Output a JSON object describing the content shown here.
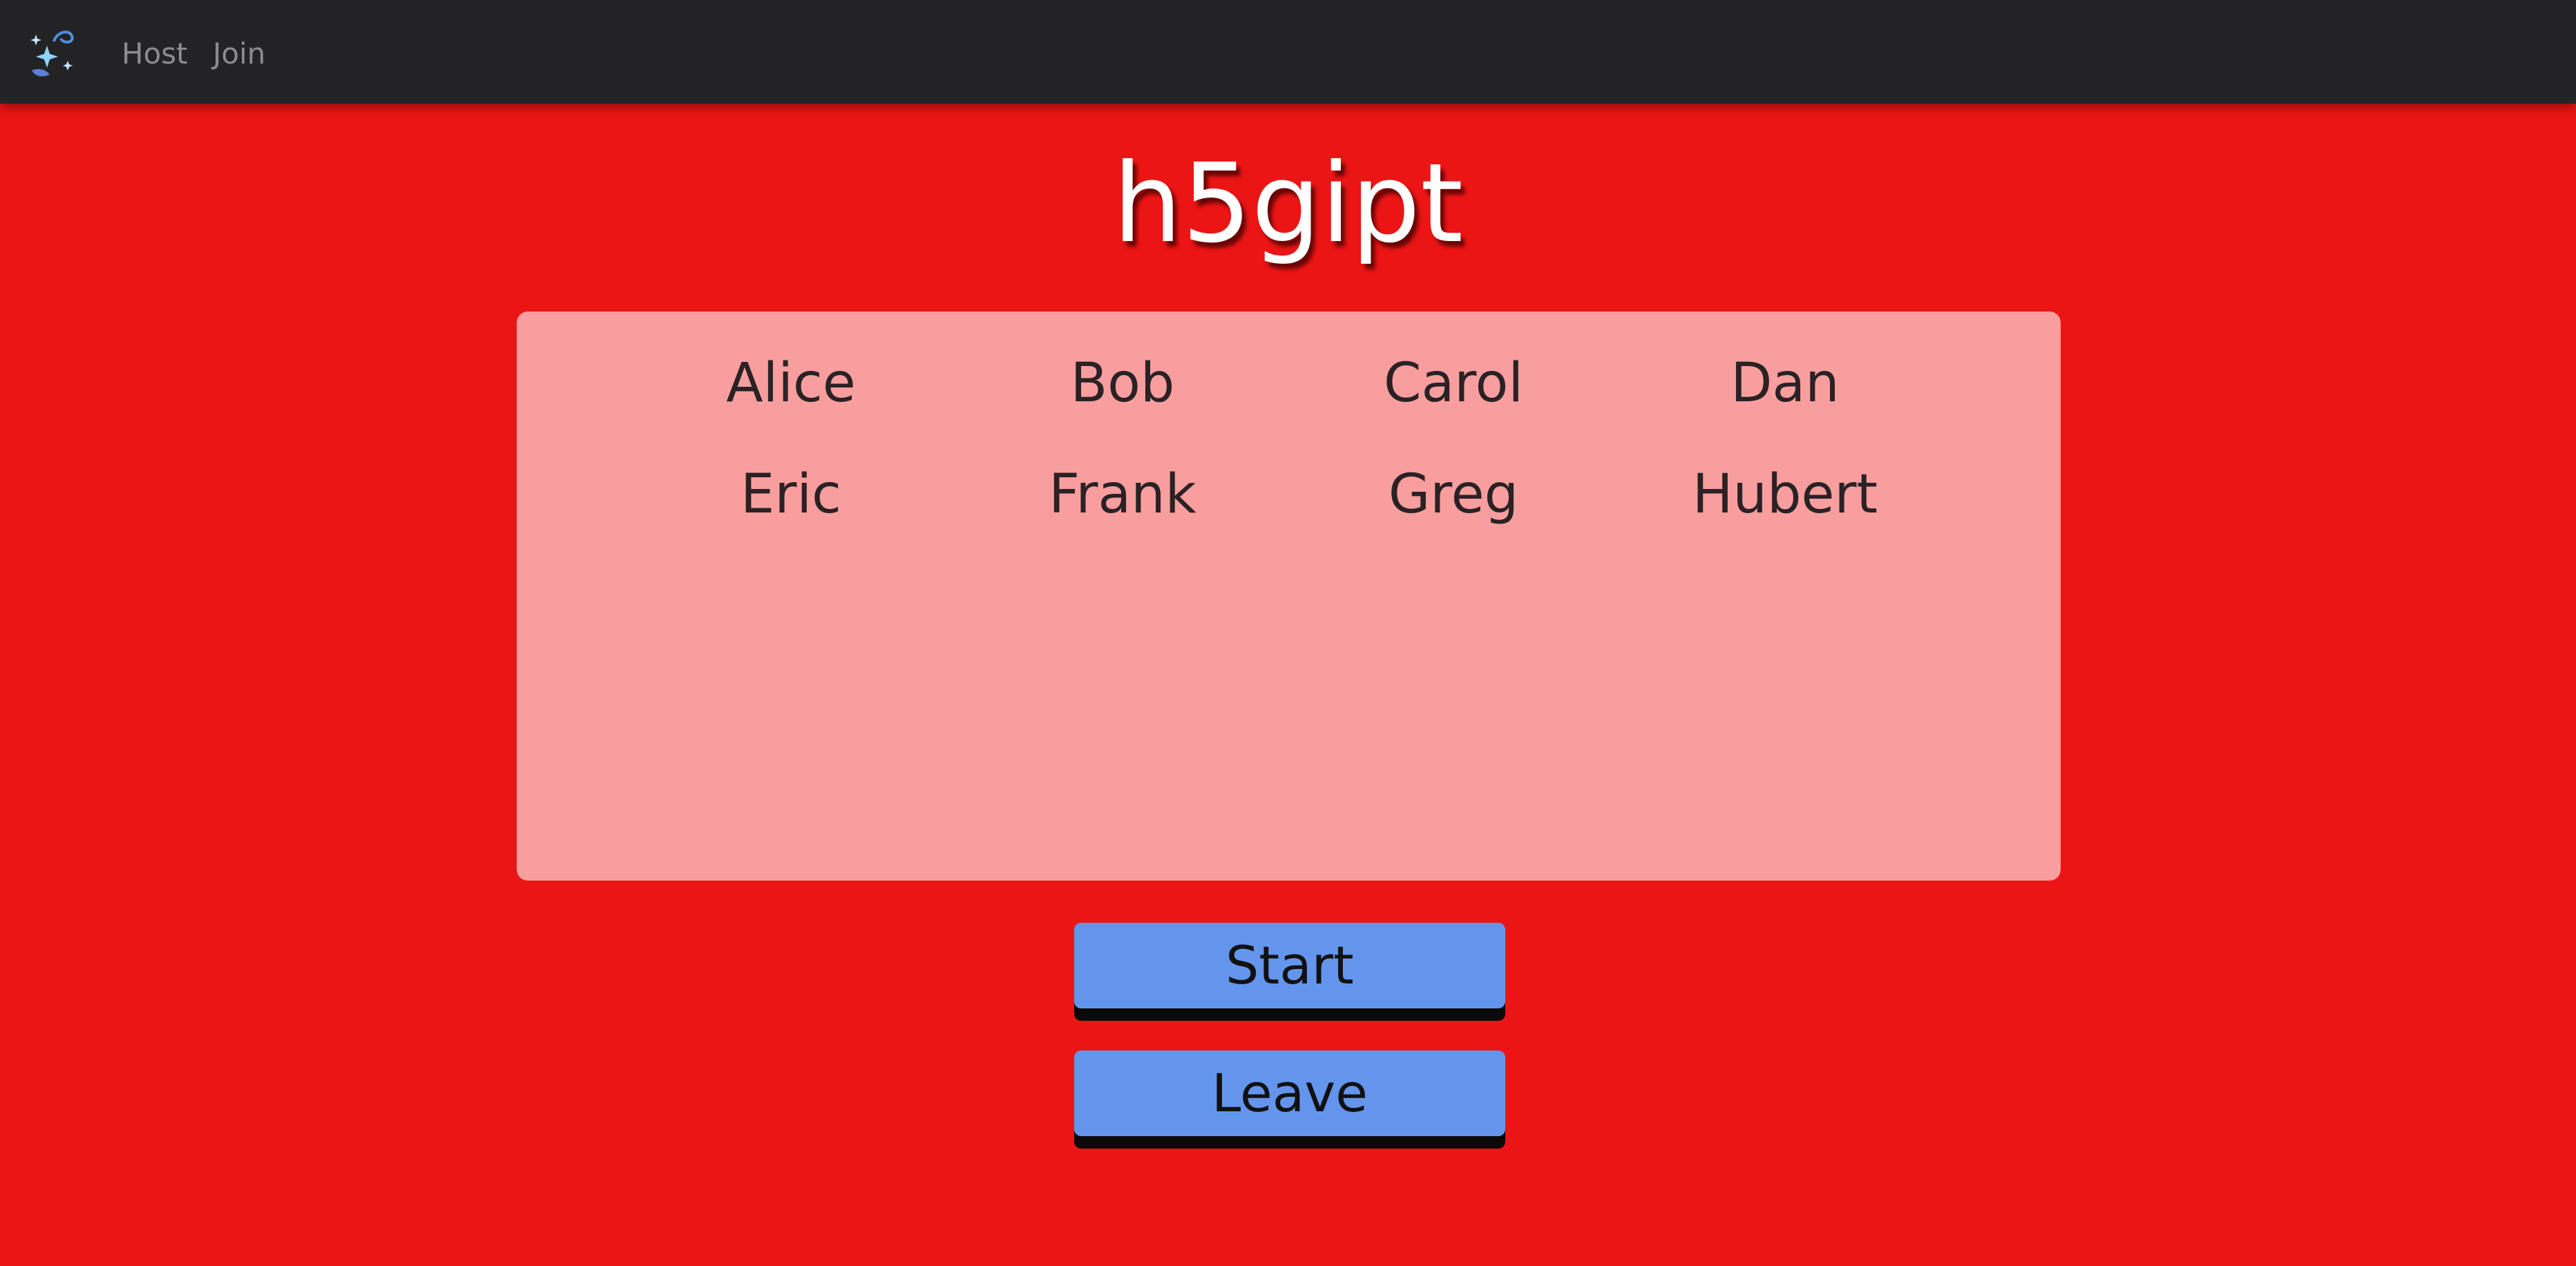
{
  "nav": {
    "logo_icon": "sparkles-magic-wand-icon",
    "links": [
      {
        "label": "Host"
      },
      {
        "label": "Join"
      }
    ]
  },
  "room": {
    "code": "h5gipt"
  },
  "players": [
    "Alice",
    "Bob",
    "Carol",
    "Dan",
    "Eric",
    "Frank",
    "Greg",
    "Hubert"
  ],
  "actions": {
    "start_label": "Start",
    "leave_label": "Leave"
  },
  "colors": {
    "background": "#ec1515",
    "navbar": "#232325",
    "panel": "#f99e9e",
    "button": "#6495ed"
  }
}
